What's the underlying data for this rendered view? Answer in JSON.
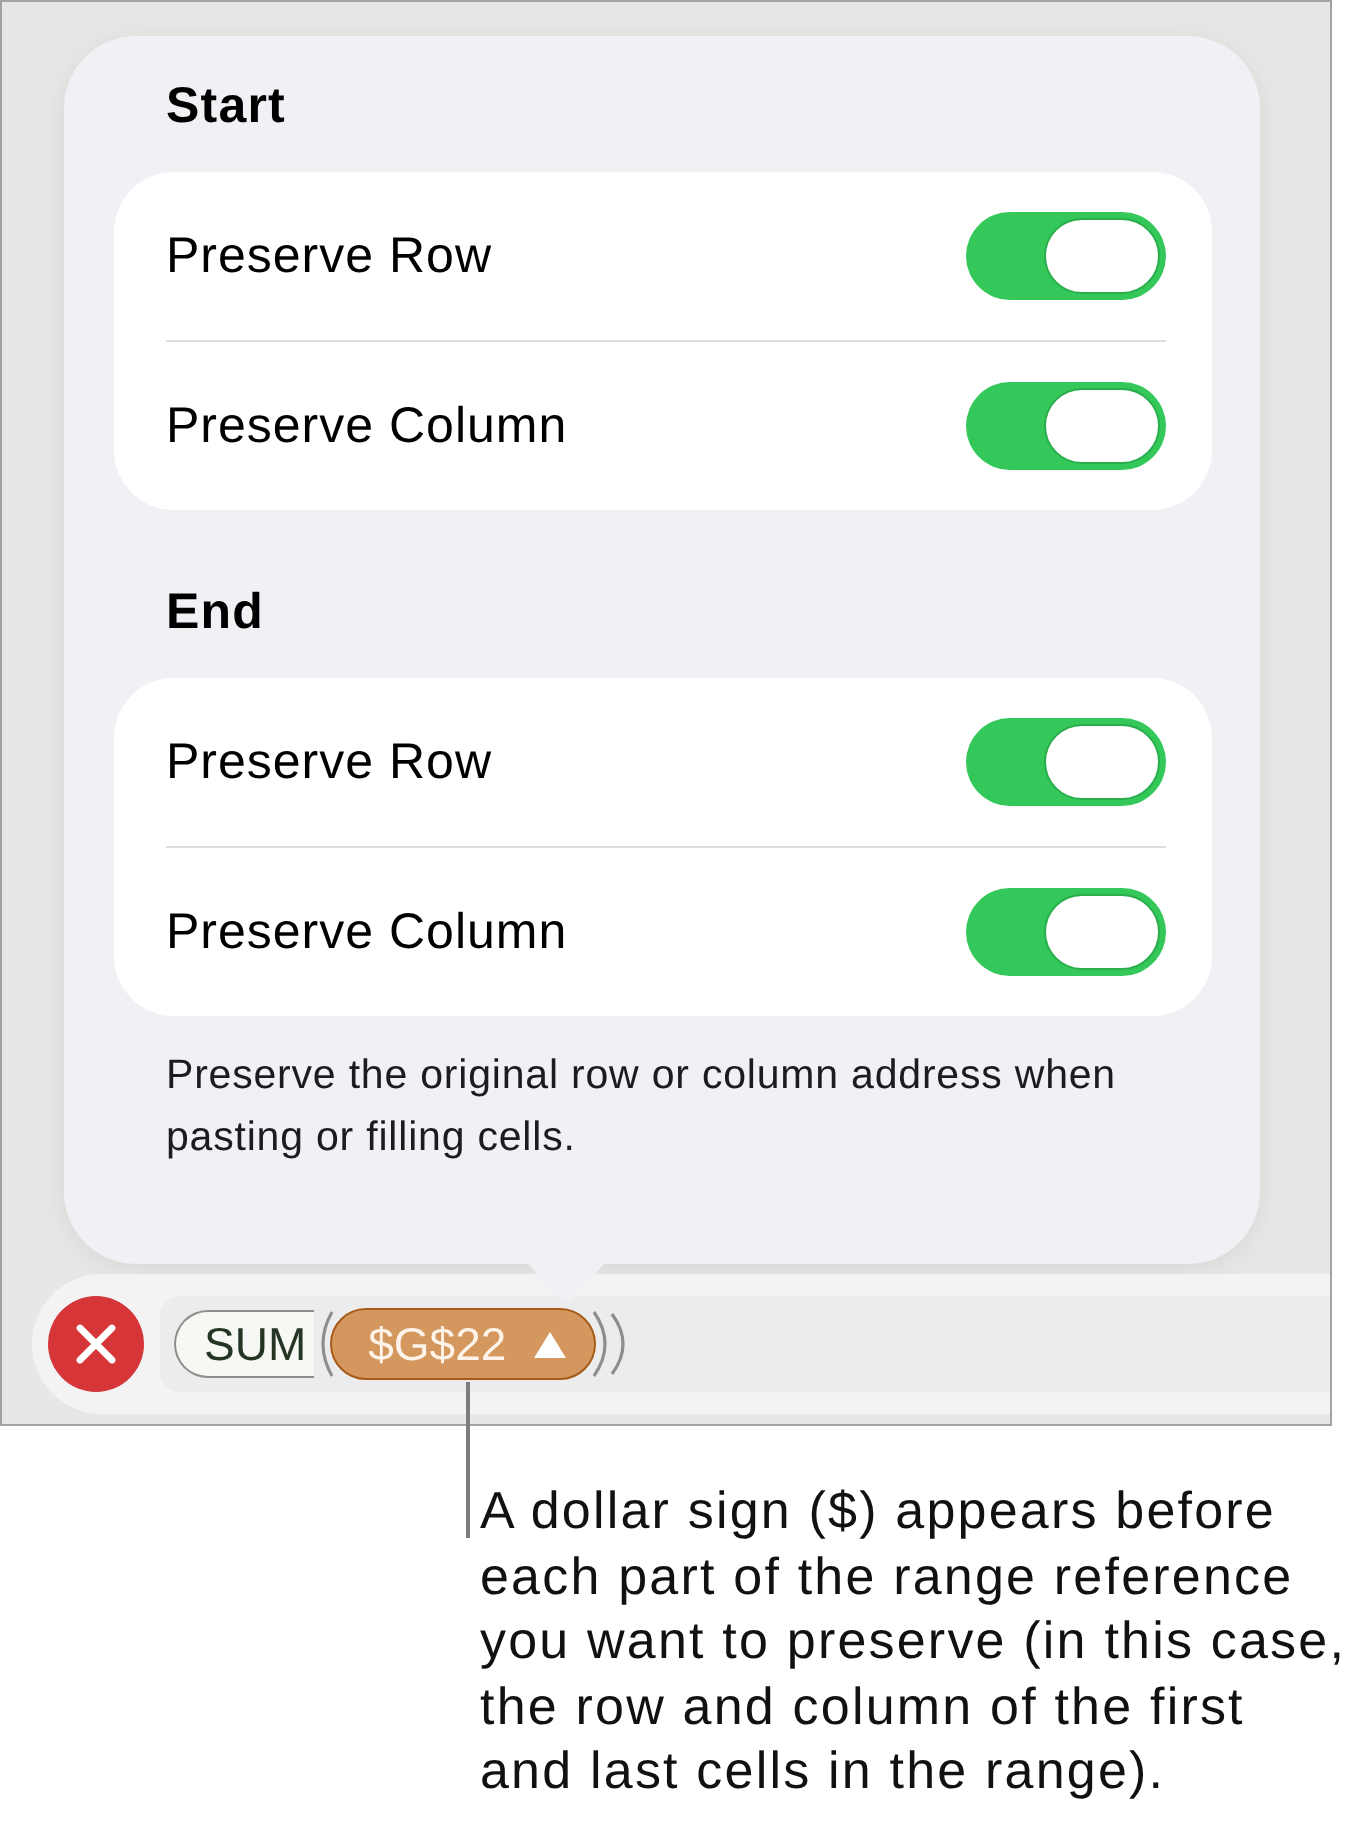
{
  "popover": {
    "sections": [
      {
        "title": "Start",
        "rows": [
          {
            "label": "Preserve Row",
            "on": true
          },
          {
            "label": "Preserve Column",
            "on": true
          }
        ]
      },
      {
        "title": "End",
        "rows": [
          {
            "label": "Preserve Row",
            "on": true
          },
          {
            "label": "Preserve Column",
            "on": true
          }
        ]
      }
    ],
    "footnote": "Preserve the original row or column address when pasting or filling cells."
  },
  "formula_bar": {
    "function_name": "SUM",
    "arguments": [
      {
        "kind": "reference",
        "text": "$G$22",
        "selected": true
      }
    ]
  },
  "callout": {
    "text": "A dollar sign ($) appears before\neach part of the range reference\nyou want to preserve (in this case,\nthe row and column of the first\nand last cells in the range)."
  }
}
